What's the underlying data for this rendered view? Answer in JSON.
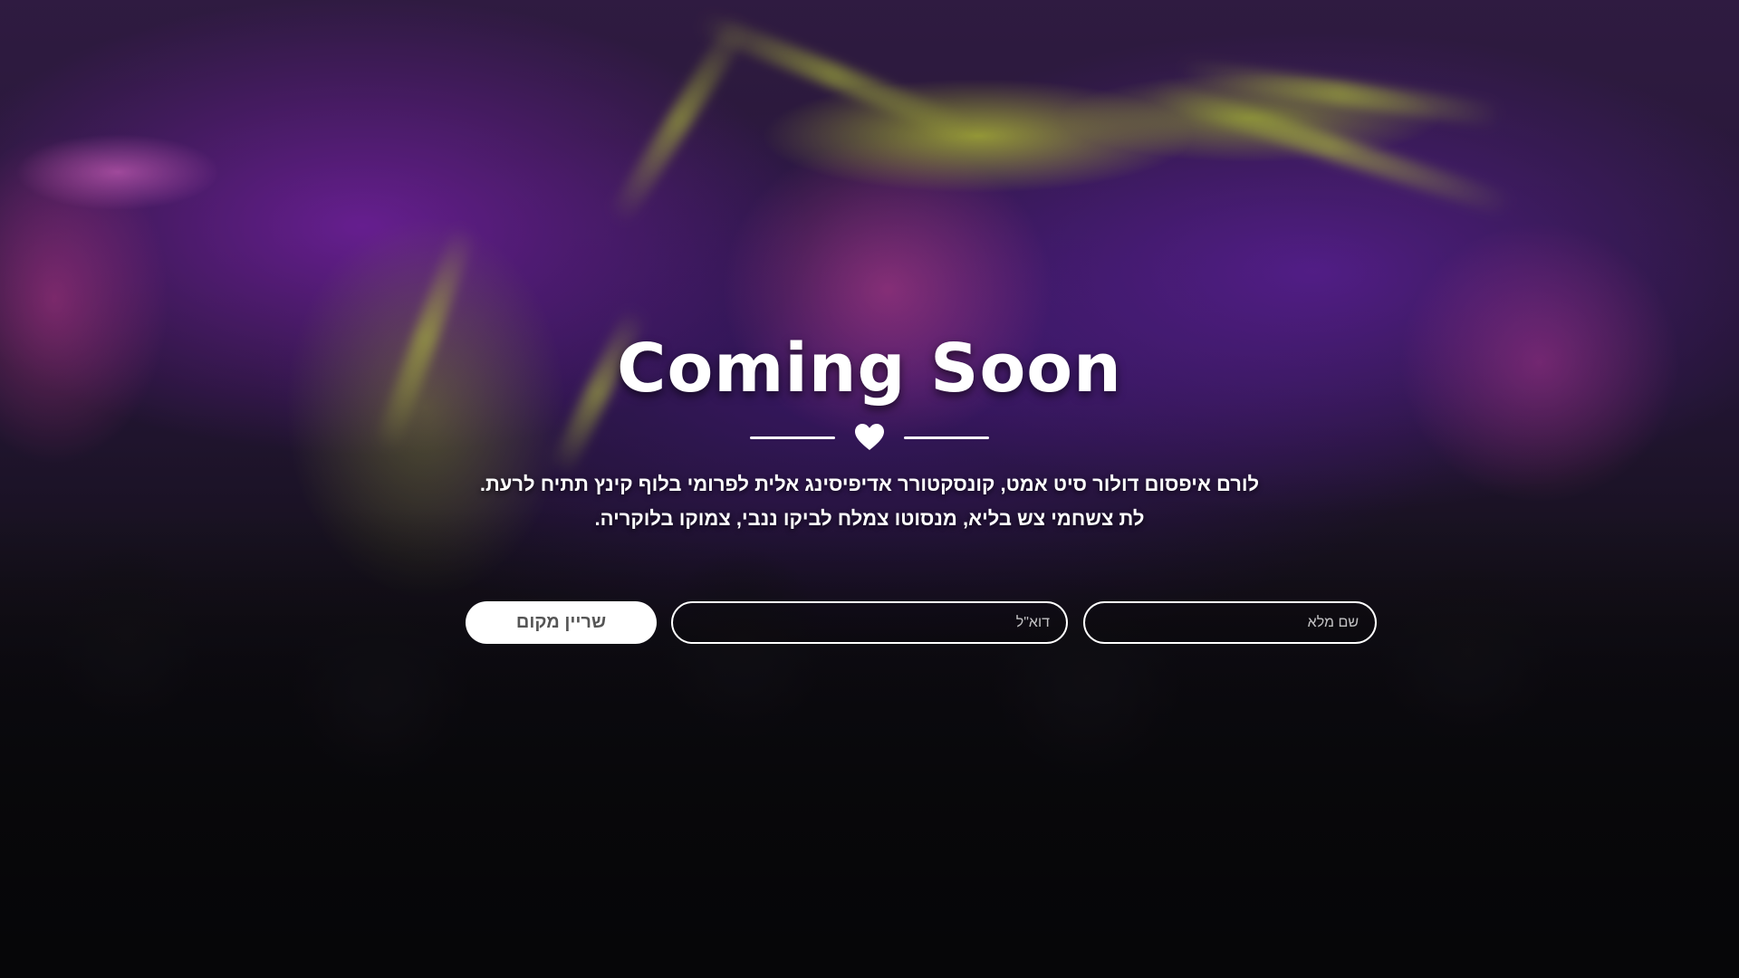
{
  "hero": {
    "title": "Coming Soon",
    "divider_icon": "heart-icon",
    "description_lines": [
      "לורם איפסום דולור סיט אמט, קונסקטורר אדיפיסינג אלית לפרומי בלוף קינץ תתיח לרעת.",
      "לת צשחמי צש בליא, מנסוטו צמלח לביקו ננבי, צמוקו בלוקריה."
    ]
  },
  "signup_form": {
    "name_placeholder": "שם מלא",
    "email_placeholder": "דוא\"ל",
    "submit_label": "שריין מקום"
  },
  "colors": {
    "text": "#ffffff",
    "button_bg": "#ffffff",
    "button_text": "#555555"
  }
}
